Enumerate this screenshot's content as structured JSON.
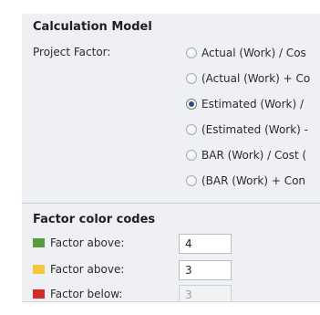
{
  "calculation_model": {
    "title": "Calculation Model",
    "project_factor_label": "Project Factor:",
    "options": [
      {
        "label": "Actual (Work) / Cos",
        "checked": false
      },
      {
        "label": "(Actual (Work) + Co",
        "checked": false
      },
      {
        "label": "Estimated (Work) /",
        "checked": true
      },
      {
        "label": "(Estimated (Work) -",
        "checked": false
      },
      {
        "label": "BAR (Work) / Cost (",
        "checked": false
      },
      {
        "label": "(BAR (Work) + Con",
        "checked": false
      }
    ]
  },
  "factor_color_codes": {
    "title": "Factor color codes",
    "rows": [
      {
        "label": "Factor above:",
        "color": "#5b9a3c",
        "value": "4",
        "enabled": true
      },
      {
        "label": "Factor above:",
        "color": "#f5c542",
        "value": "3",
        "enabled": true
      },
      {
        "label": "Factor below:",
        "color": "#d42a2a",
        "value": "3",
        "enabled": false
      }
    ]
  }
}
